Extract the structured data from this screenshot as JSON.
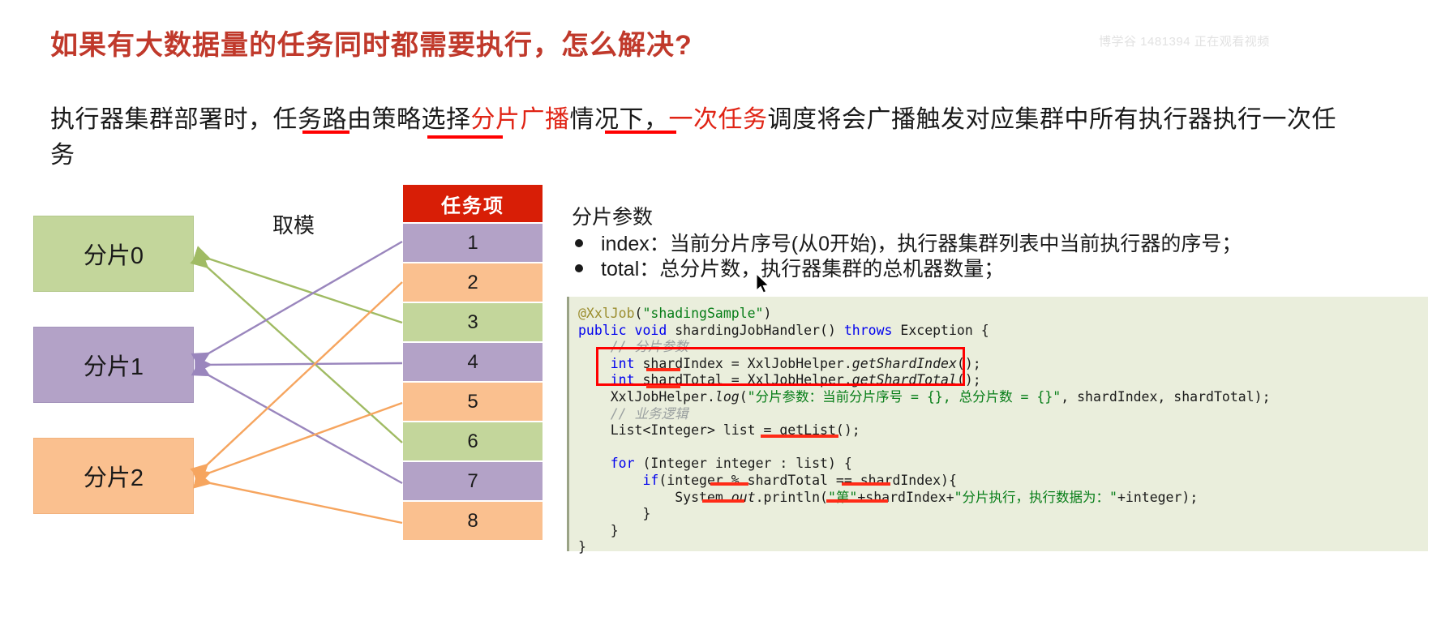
{
  "watermark": "博学谷 1481394 正在观看视频",
  "slide": {
    "title": "如果有大数据量的任务同时都需要执行，怎么解决?",
    "paragraph": {
      "part1": "执行器集群部署时，任务路由策略选择",
      "highlight1": "分片广播",
      "part2": "情况下，",
      "highlight2": "一次任务",
      "part3": "调度将会广播触发对应集群中所有执行器执行一次任务"
    }
  },
  "diagram": {
    "mod_label": "取模",
    "shards": [
      {
        "label": "分片0",
        "color": "#c3d69b"
      },
      {
        "label": "分片1",
        "color": "#b3a2c7"
      },
      {
        "label": "分片2",
        "color": "#fac08f"
      }
    ],
    "table": {
      "header": "任务项",
      "header_color": "#d81e06",
      "rows": [
        {
          "value": "1",
          "color": "#b3a2c7"
        },
        {
          "value": "2",
          "color": "#fac08f"
        },
        {
          "value": "3",
          "color": "#c3d69b"
        },
        {
          "value": "4",
          "color": "#b3a2c7"
        },
        {
          "value": "5",
          "color": "#fac08f"
        },
        {
          "value": "6",
          "color": "#c3d69b"
        },
        {
          "value": "7",
          "color": "#b3a2c7"
        },
        {
          "value": "8",
          "color": "#fac08f"
        }
      ]
    }
  },
  "params": {
    "title": "分片参数",
    "bullets": [
      "index：当前分片序号(从0开始)，执行器集群列表中当前执行器的序号；",
      "total：总分片数，执行器集群的总机器数量；"
    ]
  },
  "code": {
    "l1_anno": "@XxlJob",
    "l1_str": "\"shadingSample\"",
    "l2_kw1": "public",
    "l2_kw2": "void",
    "l2_name": " shardingJobHandler() ",
    "l2_kw3": "throws",
    "l2_rest": " Exception {",
    "l3_comment": "// 分片参数",
    "l4_kw": "int",
    "l4_rest": " shardIndex = XxlJobHelper.",
    "l4_mth": "getShardIndex",
    "l4_tail": "();",
    "l5_kw": "int",
    "l5_rest": " shardTotal = XxlJobHelper.",
    "l5_mth": "getShardTotal",
    "l5_tail": "();",
    "l6_pre": "XxlJobHelper.",
    "l6_mth": "log",
    "l6_open": "(",
    "l6_str": "\"分片参数：当前分片序号 = {}, 总分片数 = {}\"",
    "l6_tail": ", shardIndex, shardTotal);",
    "l7_comment": "// 业务逻辑",
    "l8": "List<Integer> list = getList();",
    "l9_kw": "for",
    "l9_rest": " (Integer integer : list) {",
    "l10_kw": "if",
    "l10_rest": "(integer % shardTotal == shardIndex){",
    "l11_pre": "System.",
    "l11_out": "out",
    "l11_mid": ".println(",
    "l11_s1": "\"第\"",
    "l11_m1": "+shardIndex+",
    "l11_s2": "\"分片执行，执行数据为：\"",
    "l11_m2": "+integer);",
    "l12": "}",
    "l13": "}",
    "l14": "}"
  }
}
